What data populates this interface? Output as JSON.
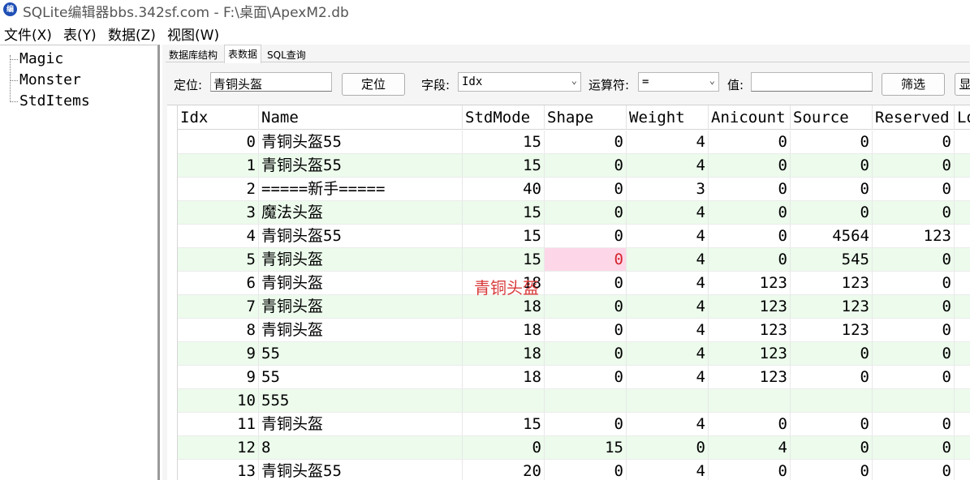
{
  "window": {
    "title": "SQLite编辑器bbs.342sf.com - F:\\桌面\\ApexM2.db",
    "icon_text": "编"
  },
  "menu": [
    {
      "label": "文件(X)"
    },
    {
      "label": "表(Y)"
    },
    {
      "label": "数据(Z)"
    },
    {
      "label": "视图(W)"
    }
  ],
  "tree": [
    {
      "label": "Magic"
    },
    {
      "label": "Monster"
    },
    {
      "label": "StdItems"
    }
  ],
  "tabs": [
    {
      "label": "数据库结构",
      "active": false
    },
    {
      "label": "表数据",
      "active": true
    },
    {
      "label": "SQL查询",
      "active": false
    }
  ],
  "filter": {
    "locate_label": "定位:",
    "locate_value": "青铜头盔",
    "locate_button": "定位",
    "field_label": "字段:",
    "field_value": "Idx",
    "operator_label": "运算符:",
    "operator_value": "=",
    "value_label": "值:",
    "value_value": "",
    "filter_button": "筛选",
    "extra_button": "显"
  },
  "grid": {
    "columns": [
      "Idx",
      "Name",
      "StdMode",
      "Shape",
      "Weight",
      "Anicount",
      "Source",
      "Reserved",
      "Lo"
    ],
    "rows": [
      [
        "0",
        "青铜头盔55",
        "15",
        "0",
        "4",
        "0",
        "0",
        "0"
      ],
      [
        "1",
        "青铜头盔55",
        "15",
        "0",
        "4",
        "0",
        "0",
        "0"
      ],
      [
        "2",
        "=====新手=====",
        "40",
        "0",
        "3",
        "0",
        "0",
        "0"
      ],
      [
        "3",
        "魔法头盔",
        "15",
        "0",
        "4",
        "0",
        "0",
        "0"
      ],
      [
        "4",
        "青铜头盔55",
        "15",
        "0",
        "4",
        "0",
        "4564",
        "123"
      ],
      [
        "5",
        "青铜头盔",
        "15",
        "0",
        "4",
        "0",
        "545",
        "0"
      ],
      [
        "6",
        "青铜头盔",
        "18",
        "0",
        "4",
        "123",
        "123",
        "0"
      ],
      [
        "7",
        "青铜头盔",
        "18",
        "0",
        "4",
        "123",
        "123",
        "0"
      ],
      [
        "8",
        "青铜头盔",
        "18",
        "0",
        "4",
        "123",
        "123",
        "0"
      ],
      [
        "9",
        "55",
        "18",
        "0",
        "4",
        "123",
        "0",
        "0"
      ],
      [
        "9",
        "55",
        "18",
        "0",
        "4",
        "123",
        "0",
        "0"
      ],
      [
        "10",
        "555",
        "",
        "",
        "",
        "",
        "",
        ""
      ],
      [
        "11",
        "青铜头盔",
        "15",
        "0",
        "4",
        "0",
        "0",
        "0"
      ],
      [
        "12",
        "8",
        "0",
        "15",
        "0",
        "4",
        "0",
        "0"
      ],
      [
        "13",
        "青铜头盔55",
        "20",
        "0",
        "4",
        "0",
        "0",
        "0"
      ]
    ],
    "current_row": 5,
    "selected_column": 3,
    "hint_text": "青铜头盔"
  },
  "colors": {
    "alt_row": "#ecfbec",
    "selected_cell": "#fdd7e7",
    "hint": "#d83a3a"
  }
}
